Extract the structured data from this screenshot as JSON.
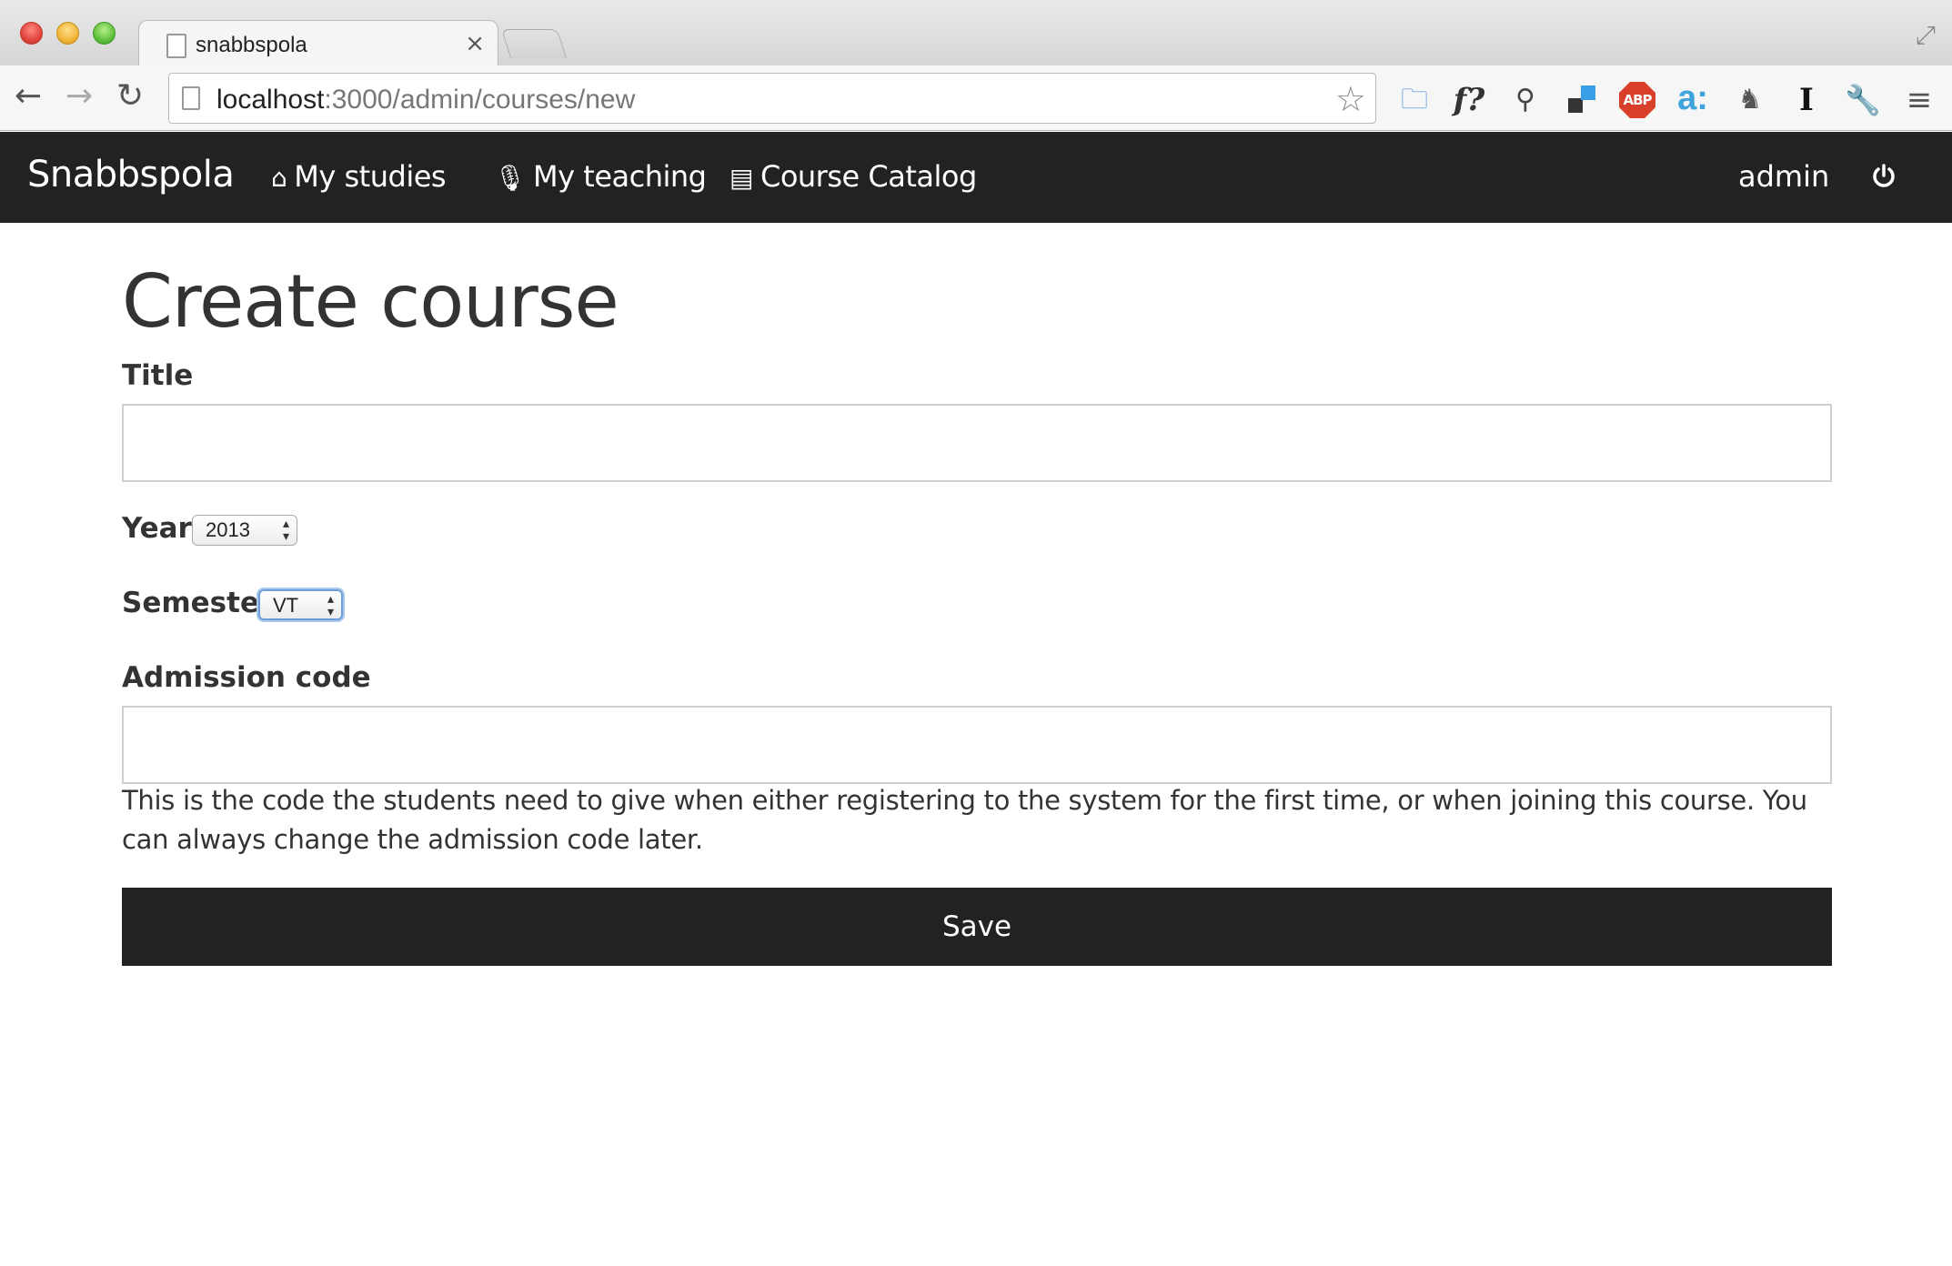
{
  "browser": {
    "tab_title": "snabbspola",
    "tab_close": "×",
    "url_host": "localhost",
    "url_rest": ":3000/admin/courses/new"
  },
  "navbar": {
    "brand": "Snabbspola",
    "links": [
      {
        "label": "My studies",
        "icon": "home-icon"
      },
      {
        "label": "My teaching",
        "icon": "microphone-icon"
      },
      {
        "label": "Course Catalog",
        "icon": "archive-icon"
      }
    ],
    "user": "admin",
    "logout_icon": "power-icon"
  },
  "form": {
    "heading": "Create course",
    "title_label": "Title",
    "title_value": "",
    "year_label": "Year",
    "year_value": "2013",
    "semester_label": "Semester",
    "semester_value": "VT",
    "admission_label": "Admission code",
    "admission_value": "",
    "admission_help": "This is the code the students need to give when either registering to the system for the first time, or when joining this course. You can always change the admission code later.",
    "save_label": "Save"
  },
  "colors": {
    "navbar_bg": "#222222",
    "button_bg": "#222222",
    "focus_ring": "#6d9fd6"
  }
}
